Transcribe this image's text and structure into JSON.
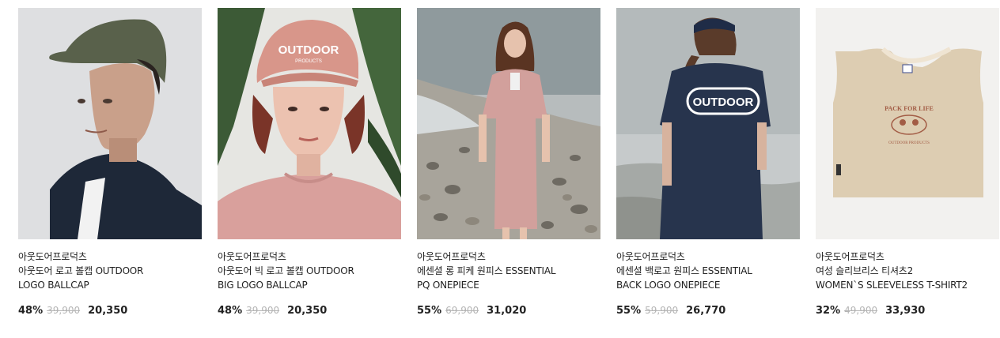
{
  "products": [
    {
      "brand": "아웃도어프로덕츠",
      "name_line1": "아웃도어 로고 볼캡 OUTDOOR",
      "name_line2": "LOGO BALLCAP",
      "discount": "48%",
      "original_price": "39,900",
      "sale_price": "20,350"
    },
    {
      "brand": "아웃도어프로덕츠",
      "name_line1": "아웃도어 빅 로고 볼캡 OUTDOOR",
      "name_line2": "BIG LOGO BALLCAP",
      "discount": "48%",
      "original_price": "39,900",
      "sale_price": "20,350"
    },
    {
      "brand": "아웃도어프로덕츠",
      "name_line1": "에센셜 롱 피케 원피스 ESSENTIAL",
      "name_line2": "PQ ONEPIECE",
      "discount": "55%",
      "original_price": "69,900",
      "sale_price": "31,020"
    },
    {
      "brand": "아웃도어프로덕츠",
      "name_line1": "에센셜 백로고 원피스 ESSENTIAL",
      "name_line2": "BACK LOGO ONEPIECE",
      "discount": "55%",
      "original_price": "59,900",
      "sale_price": "26,770"
    },
    {
      "brand": "아웃도어프로덕츠",
      "name_line1": "여성 슬리브리스 티셔츠2",
      "name_line2": "WOMEN`S SLEEVELESS T-SHIRT2",
      "discount": "32%",
      "original_price": "49,900",
      "sale_price": "33,930"
    }
  ],
  "image_text": {
    "cap_logo": "OUTDOOR",
    "cap_logo_sub": "PRODUCTS",
    "back_logo": "OUTDOOR",
    "tank_print_line1": "PACK FOR LIFE",
    "tank_print_line2": "OUTDOOR PRODUCTS"
  }
}
